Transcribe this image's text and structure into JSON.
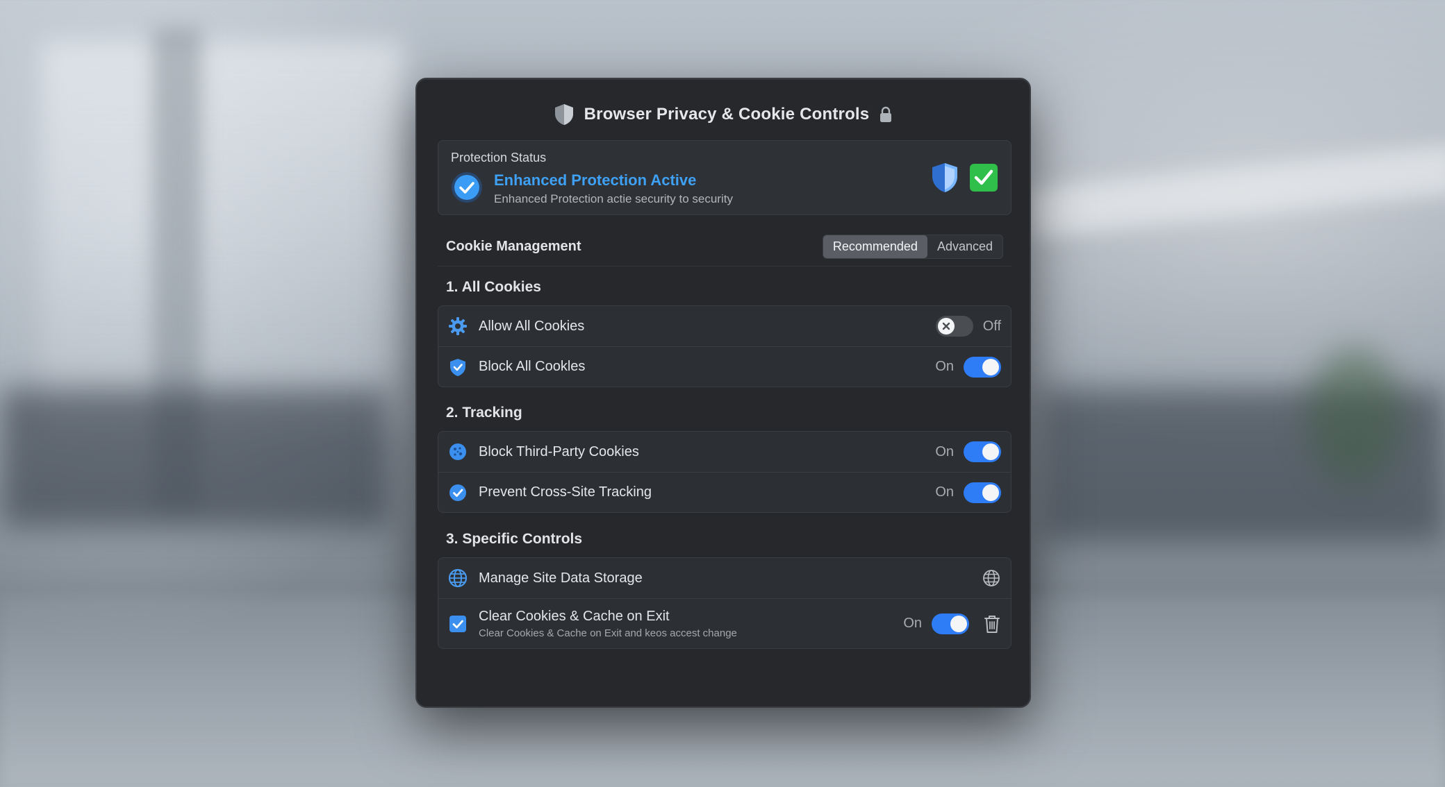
{
  "window": {
    "title": "Browser Privacy & Cookie Controls",
    "icons": {
      "shield": "shield-icon",
      "lock": "lock-icon"
    }
  },
  "status": {
    "heading": "Protection Status",
    "title": "Enhanced Protection Active",
    "subtitle": "Enhanced Protection actie security to security",
    "icons": {
      "check": "check-circle-icon",
      "shield": "shield-icon",
      "verified": "green-check-icon"
    }
  },
  "cookie_management": {
    "title": "Cookie Management",
    "tabs": [
      {
        "label": "Recommended",
        "active": true
      },
      {
        "label": "Advanced",
        "active": false
      }
    ]
  },
  "groups": [
    {
      "title": "1. All Cookies",
      "rows": [
        {
          "label": "Allow All Cookies",
          "state": "Off",
          "on": false,
          "icon": "gear-icon"
        },
        {
          "label": "Block All Cookles",
          "state": "On",
          "on": true,
          "icon": "shield-check-icon"
        }
      ]
    },
    {
      "title": "2. Tracking",
      "rows": [
        {
          "label": "Block Third-Party Cookies",
          "state": "On",
          "on": true,
          "icon": "cookie-icon"
        },
        {
          "label": "Prevent Cross-Site Tracking",
          "state": "On",
          "on": true,
          "icon": "check-badge-icon"
        }
      ]
    },
    {
      "title": "3. Specific Controls",
      "rows": [
        {
          "label": "Manage Site Data Storage",
          "icon": "globe-icon",
          "action_icon": "globe-icon"
        },
        {
          "label": "Clear Cookies & Cache on Exit",
          "sublabel": "Clear Cookies & Cache on Exit and keos accest change",
          "state": "On",
          "on": true,
          "icon": "checkbox-icon",
          "action_icon": "trash-icon"
        }
      ]
    }
  ],
  "colors": {
    "accent": "#2f7df6",
    "status_blue": "#3ea1f5",
    "success_green": "#2fbf4a",
    "panel": "#26282c"
  }
}
